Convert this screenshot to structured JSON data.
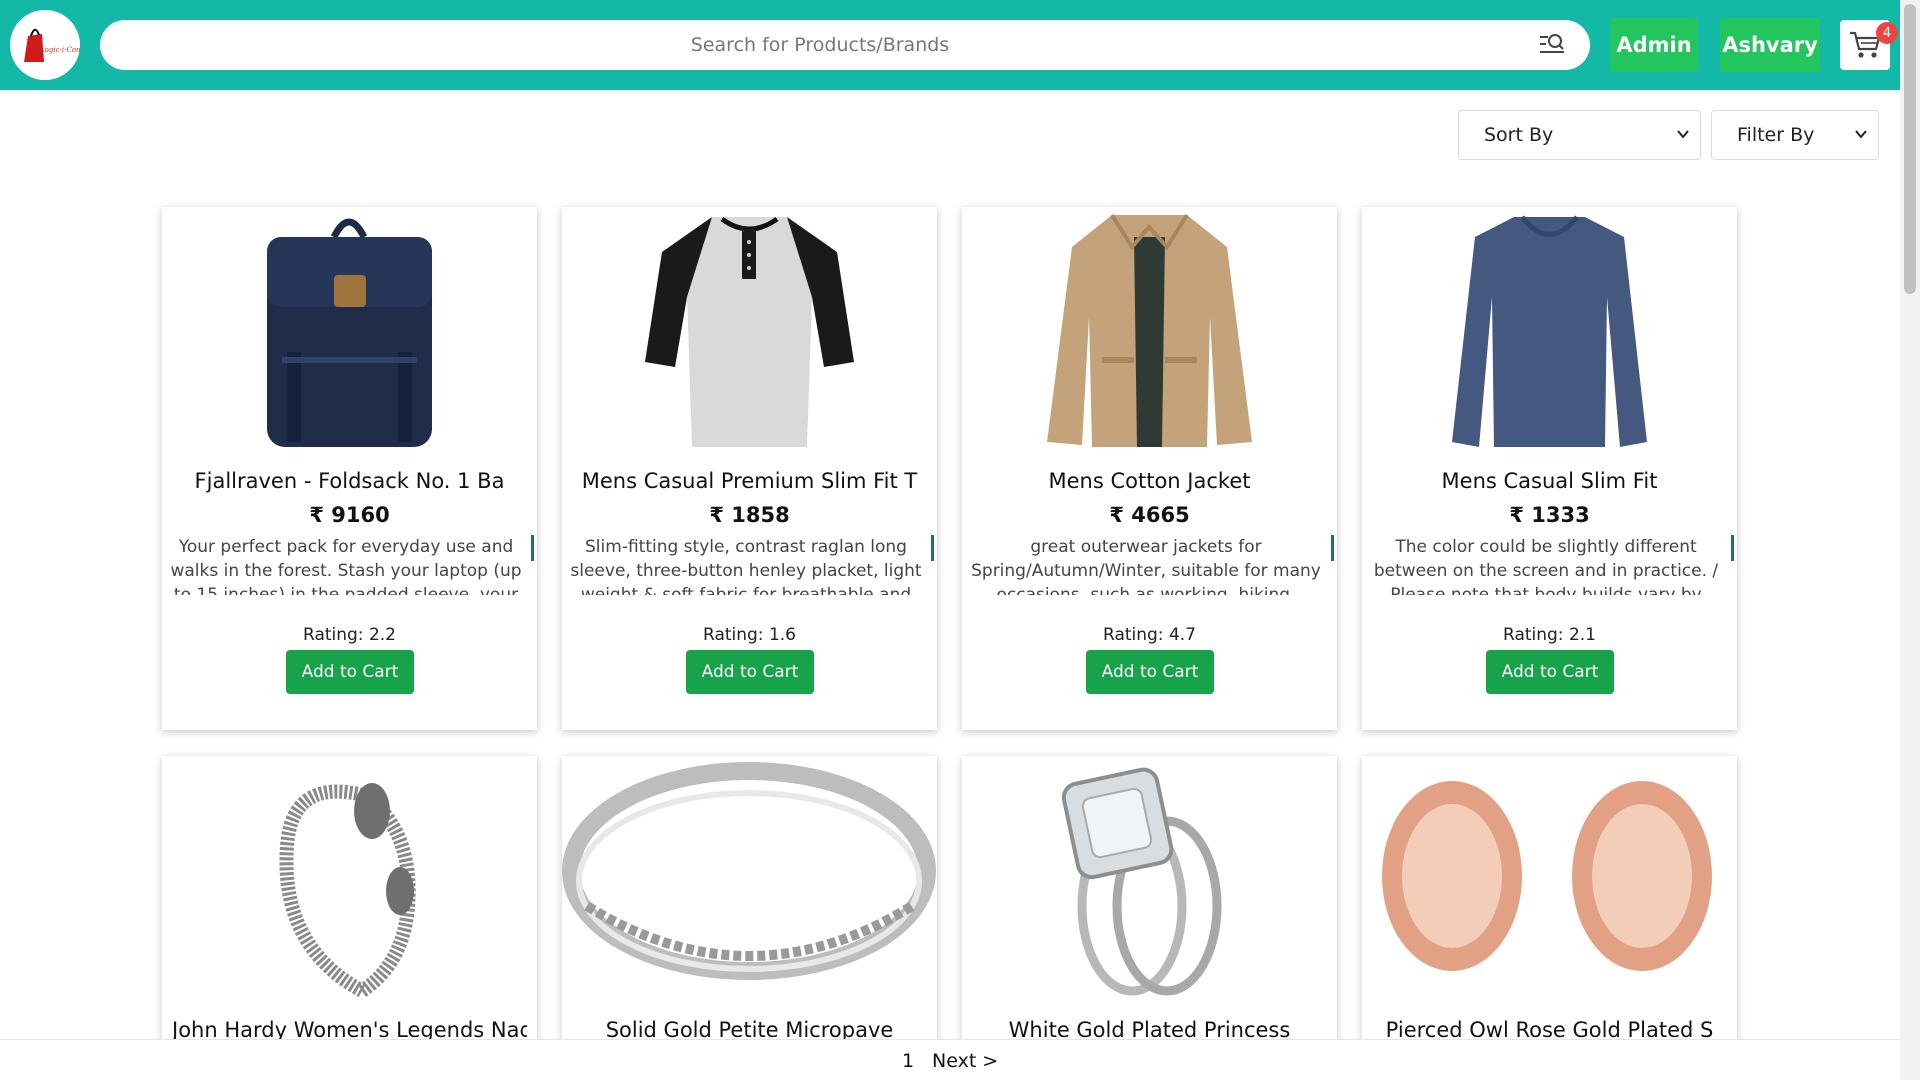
{
  "header": {
    "logo_text": "Logic-i-Com",
    "search_placeholder": "Search for Products/Brands",
    "admin_label": "Admin",
    "user_label": "Ashvary",
    "cart_count": "4"
  },
  "toolbar": {
    "sort_label": "Sort By",
    "filter_label": "Filter By"
  },
  "products": [
    {
      "title": "Fjallraven - Foldsack No. 1 Ba",
      "price": "₹ 9160",
      "description": "Your perfect pack for everyday use and walks in the forest. Stash your laptop (up to 15 inches) in the padded sleeve, your everyday",
      "rating": "Rating: 2.2",
      "button": "Add to Cart",
      "image": "backpack-image"
    },
    {
      "title": "Mens Casual Premium Slim Fit T",
      "price": "₹ 1858",
      "description": "Slim-fitting style, contrast raglan long sleeve, three-button henley placket, light weight & soft fabric for breathable and comfortable",
      "rating": "Rating: 1.6",
      "button": "Add to Cart",
      "image": "henley-shirt-image"
    },
    {
      "title": "Mens Cotton Jacket",
      "price": "₹ 4665",
      "description": "great outerwear jackets for Spring/Autumn/Winter, suitable for many occasions, such as working, hiking, camping,",
      "rating": "Rating: 4.7",
      "button": "Add to Cart",
      "image": "cotton-jacket-image"
    },
    {
      "title": "Mens Casual Slim Fit",
      "price": "₹ 1333",
      "description": "The color could be slightly different between on the screen and in practice. / Please note that body builds vary by person, therefore,",
      "rating": "Rating: 2.1",
      "button": "Add to Cart",
      "image": "long-sleeve-shirt-image"
    },
    {
      "title": "John Hardy Women's Legends Nag",
      "image": "bracelet-image"
    },
    {
      "title": "Solid Gold Petite Micropave",
      "image": "ring-image"
    },
    {
      "title": "White Gold Plated Princess",
      "image": "engagement-ring-image"
    },
    {
      "title": "Pierced Owl Rose Gold Plated S",
      "image": "tunnel-plugs-image"
    }
  ],
  "pagination": {
    "current_page": "1",
    "next_label": "Next >"
  },
  "colors": {
    "header_bg": "#14b8a6",
    "button_green": "#22c55e",
    "cart_button": "#16a34a",
    "badge_red": "#ef4444"
  }
}
